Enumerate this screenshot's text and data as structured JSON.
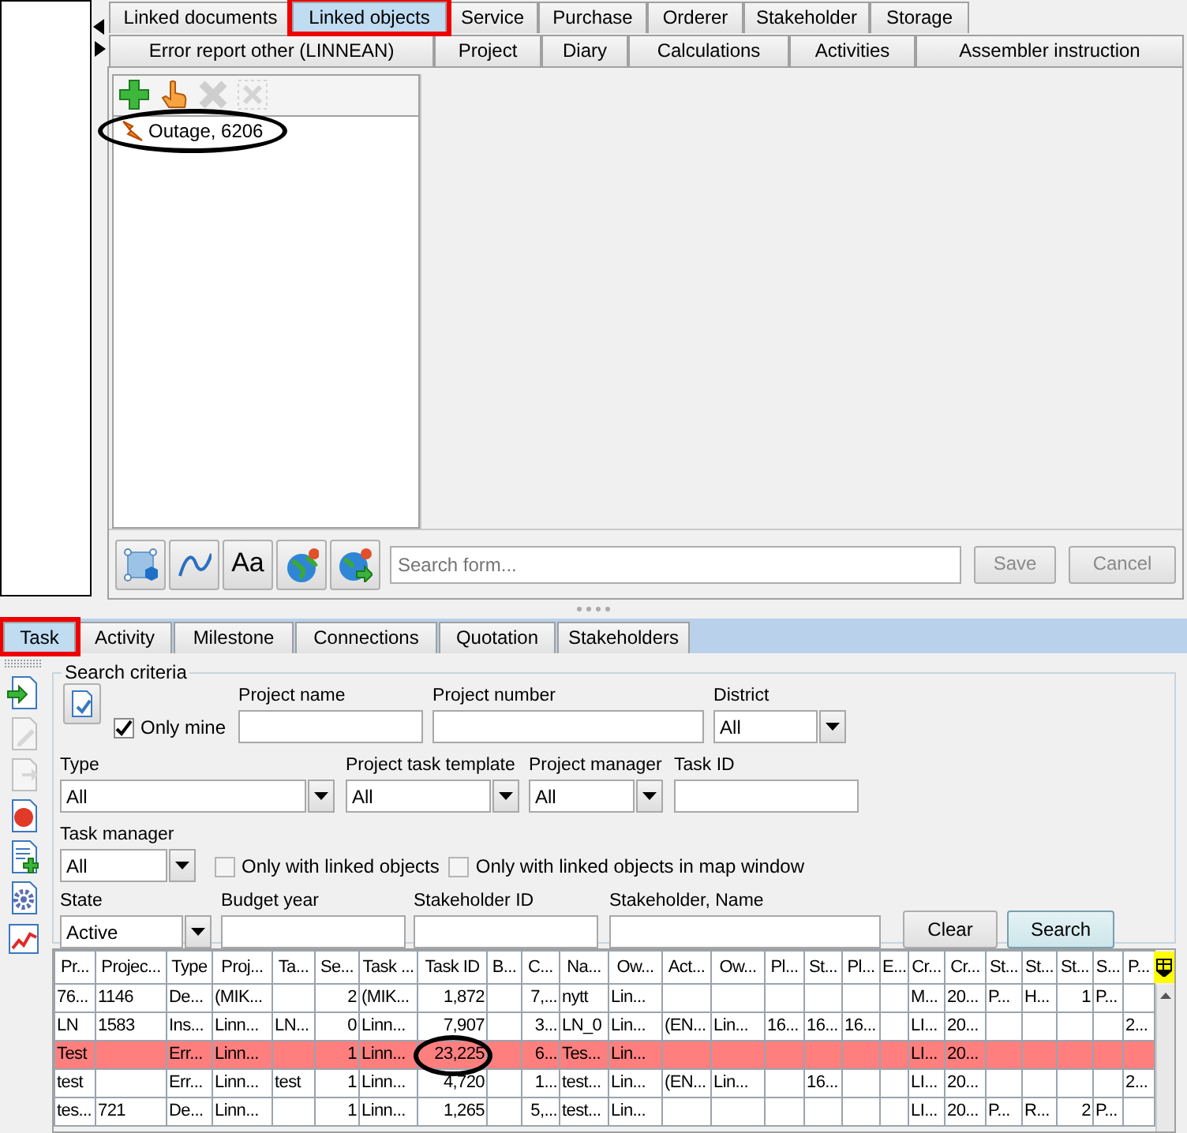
{
  "top_tabs": [
    [
      {
        "label": "Linked documents",
        "selected": false
      },
      {
        "label": "Linked objects",
        "selected": true,
        "boxed": true
      },
      {
        "label": "Service",
        "selected": false
      },
      {
        "label": "Purchase",
        "selected": false
      },
      {
        "label": "Orderer",
        "selected": false
      },
      {
        "label": "Stakeholder",
        "selected": false
      },
      {
        "label": "Storage",
        "selected": false
      }
    ],
    [
      {
        "label": "Error report other (LINNEAN)",
        "selected": false
      },
      {
        "label": "Project",
        "selected": false
      },
      {
        "label": "Diary",
        "selected": false
      },
      {
        "label": "Calculations",
        "selected": false
      },
      {
        "label": "Activities",
        "selected": false
      },
      {
        "label": "Assembler instruction",
        "selected": false
      }
    ]
  ],
  "linked_objects": {
    "toolbar": [
      {
        "kind": "add",
        "disabled": false
      },
      {
        "kind": "pick",
        "disabled": false
      },
      {
        "kind": "delete",
        "disabled": true
      },
      {
        "kind": "remove",
        "disabled": true
      }
    ],
    "items": [
      {
        "label": "Outage, 6206",
        "circled": true
      }
    ]
  },
  "form_toolbar": [
    {
      "kind": "shape"
    },
    {
      "kind": "line"
    },
    {
      "kind": "text",
      "label": "Aa"
    },
    {
      "kind": "globe"
    },
    {
      "kind": "globe-export"
    }
  ],
  "search_form": {
    "placeholder": "Search form..."
  },
  "form_buttons": [
    {
      "label": "Save",
      "disabled": true
    },
    {
      "label": "Cancel",
      "disabled": true
    }
  ],
  "bottom_tabs": [
    {
      "label": "Task",
      "selected": true,
      "boxed": true
    },
    {
      "label": "Activity",
      "selected": false
    },
    {
      "label": "Milestone",
      "selected": false
    },
    {
      "label": "Connections",
      "selected": false
    },
    {
      "label": "Quotation",
      "selected": false
    },
    {
      "label": "Stakeholders",
      "selected": false
    }
  ],
  "side_actions": [
    {
      "kind": "open",
      "disabled": false
    },
    {
      "kind": "edit",
      "disabled": true
    },
    {
      "kind": "export",
      "disabled": true
    },
    {
      "kind": "stop",
      "disabled": false
    },
    {
      "kind": "add",
      "disabled": false
    },
    {
      "kind": "settings",
      "disabled": false
    },
    {
      "kind": "chart",
      "disabled": false
    }
  ],
  "search_criteria": {
    "title": "Search criteria",
    "fields": [
      {
        "kind": "clear-icon"
      },
      {
        "kind": "checkbox",
        "label": "Only mine",
        "checked": true
      },
      {
        "kind": "text",
        "label": "Project name"
      },
      {
        "kind": "text",
        "label": "Project number"
      },
      {
        "kind": "select",
        "label": "District",
        "value": "All"
      },
      {
        "kind": "select",
        "label": "Type",
        "value": "All"
      },
      {
        "kind": "select",
        "label": "Project task template",
        "value": "All"
      },
      {
        "kind": "select",
        "label": "Project manager",
        "value": "All"
      },
      {
        "kind": "text",
        "label": "Task ID"
      },
      {
        "kind": "select",
        "label": "Task manager",
        "value": "All"
      },
      {
        "kind": "checkbox",
        "label": "Only with linked objects",
        "checked": false
      },
      {
        "kind": "checkbox",
        "label": "Only with linked objects in map window",
        "checked": false
      },
      {
        "kind": "select",
        "label": "State",
        "value": "Active"
      },
      {
        "kind": "text",
        "label": "Budget year"
      },
      {
        "kind": "text",
        "label": "Stakeholder ID"
      },
      {
        "kind": "text",
        "label": "Stakeholder, Name"
      },
      {
        "kind": "button",
        "label": "Clear",
        "primary": false
      },
      {
        "kind": "button",
        "label": "Search",
        "primary": true
      }
    ]
  },
  "table": {
    "columns": [
      "Pr...",
      "Projec...",
      "Type",
      "Proj...",
      "Ta...",
      "Se...",
      "Task ...",
      "Task ID",
      "B...",
      "C...",
      "Na...",
      "Ow...",
      "Act...",
      "Ow...",
      "Pl...",
      "St...",
      "Pl...",
      "E...",
      "Cr...",
      "Cr...",
      "St...",
      "St...",
      "St...",
      "S...",
      "P..."
    ],
    "rows": [
      {
        "highlighted": false,
        "cells": [
          "76...",
          "1146",
          "De...",
          "(MIK...",
          "",
          "2",
          "(MIK...",
          "1,872",
          "",
          "7,...",
          "nytt",
          "Lin...",
          "",
          "",
          "",
          "",
          "",
          "",
          "M...",
          "20...",
          "P...",
          "H...",
          "1",
          "P...",
          ""
        ]
      },
      {
        "highlighted": false,
        "cells": [
          "LN",
          "1583",
          "Ins...",
          "Linn...",
          "LN...",
          "0",
          "Linn...",
          "7,907",
          "",
          "3...",
          "LN_0",
          "Lin...",
          "(EN...",
          "Lin...",
          "16...",
          "16...",
          "16...",
          "",
          "LI...",
          "20...",
          "",
          "",
          "",
          "",
          "2..."
        ]
      },
      {
        "highlighted": true,
        "cells": [
          "Test",
          "",
          "Err...",
          "Linn...",
          "",
          "1",
          "Linn...",
          {
            "text": "23,225",
            "circled": true
          },
          "",
          "6...",
          "Tes...",
          "Lin...",
          "",
          "",
          "",
          "",
          "",
          "",
          "LI...",
          "20...",
          "",
          "",
          "",
          "",
          ""
        ]
      },
      {
        "highlighted": false,
        "cells": [
          "test",
          "",
          "Err...",
          "Linn...",
          "test",
          "1",
          "Linn...",
          "4,720",
          "",
          "1...",
          "test...",
          "Lin...",
          "(EN...",
          "Lin...",
          "",
          "16...",
          "",
          "",
          "LI...",
          "20...",
          "",
          "",
          "",
          "",
          "2..."
        ]
      },
      {
        "highlighted": false,
        "cells": [
          "tes...",
          "721",
          "De...",
          "Linn...",
          "",
          "1",
          "Linn...",
          "1,265",
          "",
          "5,...",
          "test...",
          "Lin...",
          "",
          "",
          "",
          "",
          "",
          "",
          "LI...",
          "20...",
          "P...",
          "R...",
          "2",
          "P...",
          ""
        ]
      }
    ]
  }
}
